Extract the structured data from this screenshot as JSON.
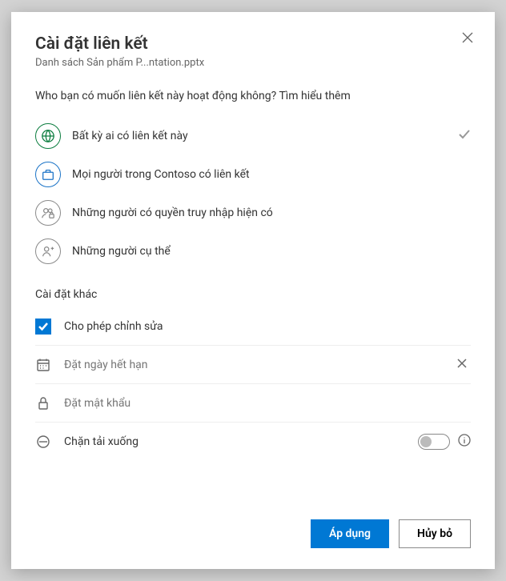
{
  "title": "Cài đặt liên kết",
  "subtitle": "Danh sách Sản phẩm P...ntation.pptx",
  "prompt": {
    "text": "Who bạn có muốn liên kết này hoạt động không?",
    "link": "Tìm hiểu thêm"
  },
  "options": [
    {
      "label": "Bất kỳ ai có liên kết này",
      "icon": "globe",
      "selected": true
    },
    {
      "label": "Mọi người trong Contoso có liên kết",
      "icon": "briefcase",
      "org": true
    },
    {
      "label": "Những người có quyền truy nhập hiện có",
      "icon": "people-lock"
    },
    {
      "label": "Những người cụ thể",
      "icon": "people-add"
    }
  ],
  "otherSettings": {
    "title": "Cài đặt khác",
    "allowEdit": {
      "label": "Cho phép chỉnh sửa",
      "checked": true
    },
    "expiry": {
      "placeholder": "Đặt ngày hết hạn",
      "value": ""
    },
    "password": {
      "placeholder": "Đặt mật khẩu",
      "value": ""
    },
    "blockDownload": {
      "label": "Chặn tải xuống",
      "enabled": false
    }
  },
  "buttons": {
    "apply": "Áp dụng",
    "cancel": "Hủy bỏ"
  }
}
